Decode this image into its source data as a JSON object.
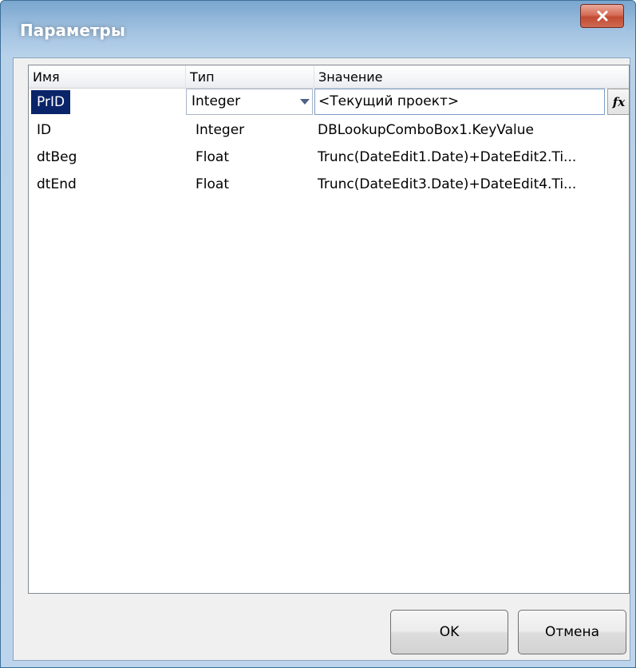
{
  "window": {
    "title": "Параметры"
  },
  "grid": {
    "columns": [
      "Имя",
      "Тип",
      "Значение"
    ],
    "rows": [
      {
        "name": "PrID",
        "type": "Integer",
        "value": "<Текущий проект>"
      },
      {
        "name": "ID",
        "type": "Integer",
        "value": "DBLookupComboBox1.KeyValue"
      },
      {
        "name": "dtBeg",
        "type": "Float",
        "value": "Trunc(DateEdit1.Date)+DateEdit2.Ti..."
      },
      {
        "name": "dtEnd",
        "type": "Float",
        "value": "Trunc(DateEdit3.Date)+DateEdit4.Ti..."
      }
    ],
    "selected_row": 0
  },
  "buttons": {
    "ok_label": "OK",
    "cancel_label": "Отмена",
    "fx_label": "fx"
  },
  "icons": {
    "close": "close-icon",
    "dropdown": "chevron-down-icon"
  },
  "colors": {
    "selection": "#0a246a",
    "close_button": "#c24b33",
    "title_bar": "#7aa6cf"
  }
}
